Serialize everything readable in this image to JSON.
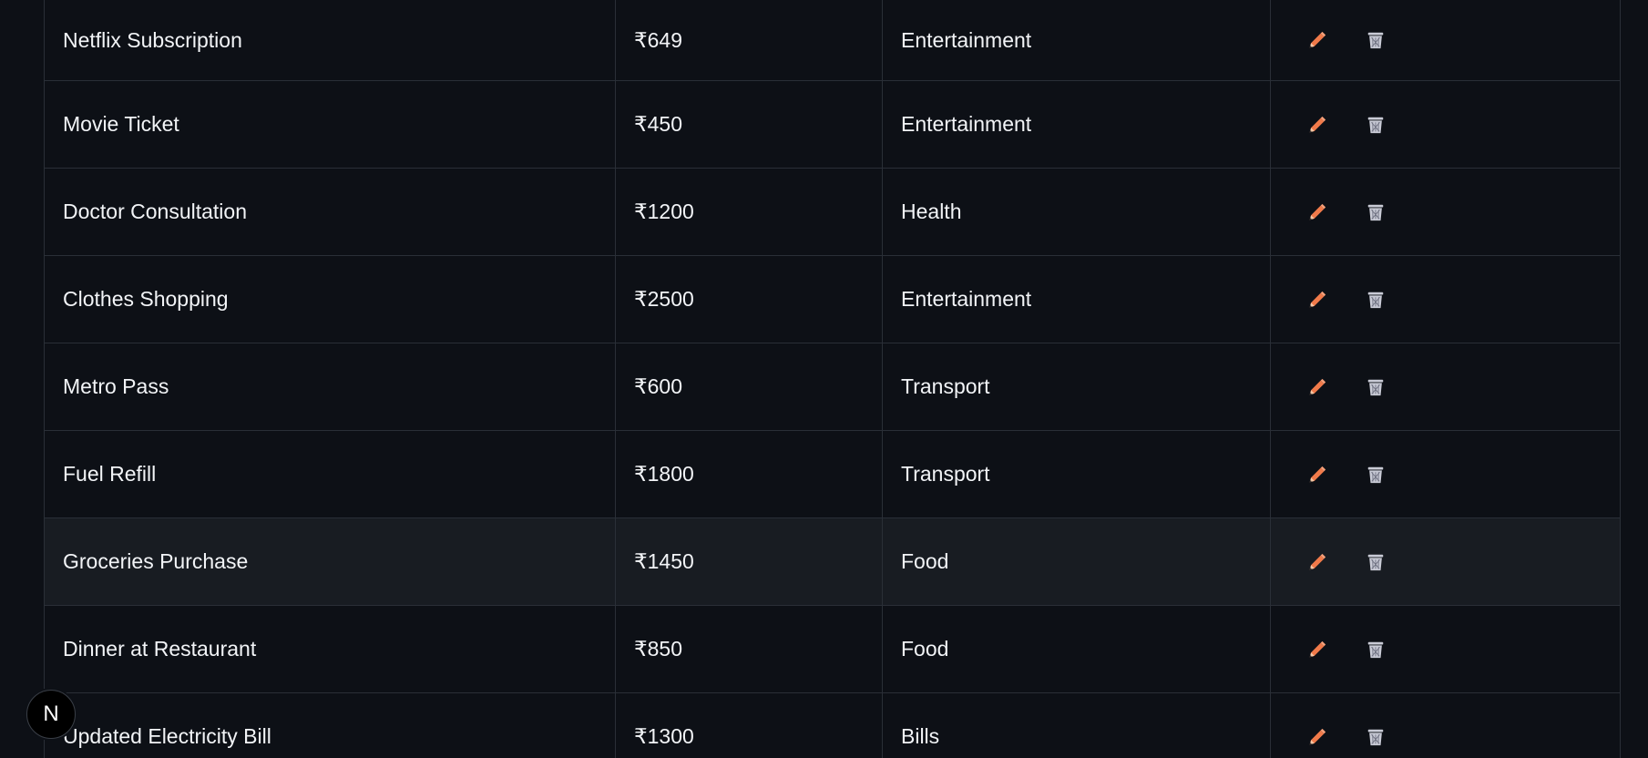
{
  "expenses": [
    {
      "name": "Netflix Subscription",
      "amount": "₹649",
      "category": "Entertainment"
    },
    {
      "name": "Movie Ticket",
      "amount": "₹450",
      "category": "Entertainment"
    },
    {
      "name": "Doctor Consultation",
      "amount": "₹1200",
      "category": "Health"
    },
    {
      "name": "Clothes Shopping",
      "amount": "₹2500",
      "category": "Entertainment"
    },
    {
      "name": "Metro Pass",
      "amount": "₹600",
      "category": "Transport"
    },
    {
      "name": "Fuel Refill",
      "amount": "₹1800",
      "category": "Transport"
    },
    {
      "name": "Groceries Purchase",
      "amount": "₹1450",
      "category": "Food"
    },
    {
      "name": "Dinner at Restaurant",
      "amount": "₹850",
      "category": "Food"
    },
    {
      "name": "Updated Electricity Bill",
      "amount": "₹1300",
      "category": "Bills"
    }
  ],
  "actions": {
    "edit_icon": "pencil-icon",
    "delete_icon": "wastebasket-icon"
  },
  "badge": {
    "letter": "N"
  },
  "colors": {
    "background": "#0d1016",
    "row_hover": "#181c22",
    "border": "#2a2f37",
    "text": "#f2f4f7",
    "pencil": "#f07a4a",
    "trash": "#c9cbd6"
  }
}
